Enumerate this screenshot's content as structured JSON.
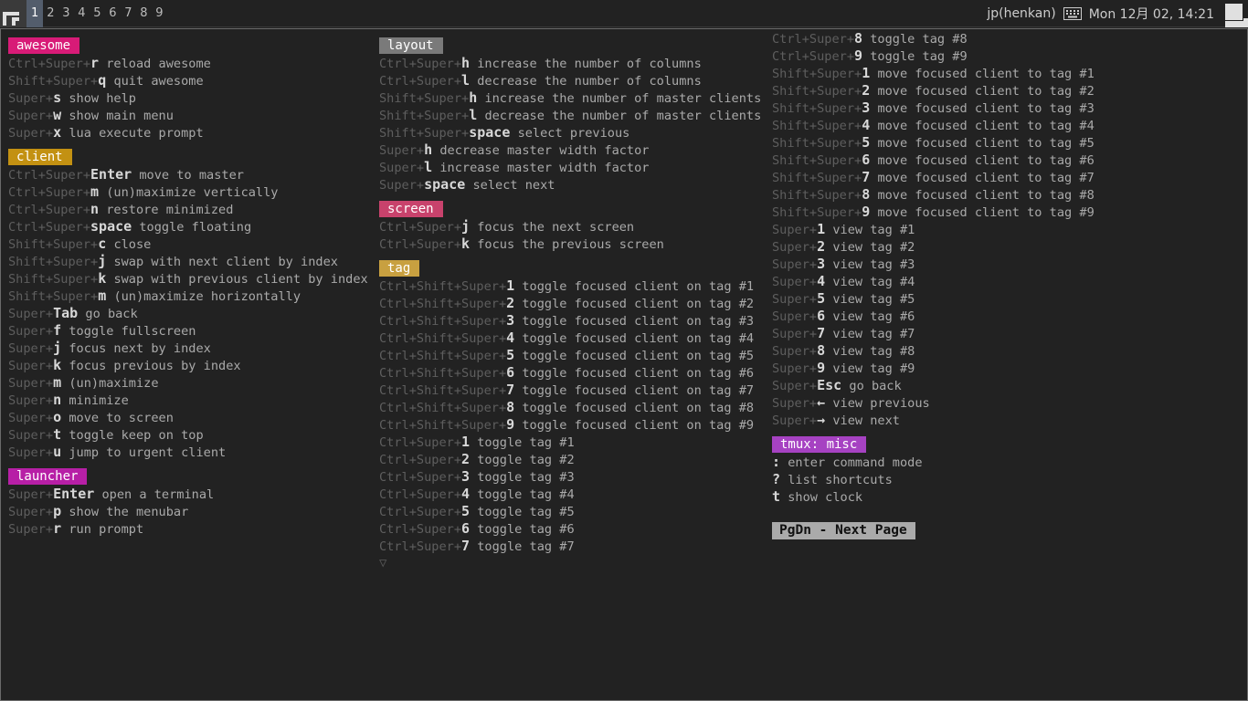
{
  "wibar": {
    "tags": [
      "1",
      "2",
      "3",
      "4",
      "5",
      "6",
      "7",
      "8",
      "9"
    ],
    "active_tag": "1",
    "keyboard_layout": "jp(henkan)",
    "keyboard_icon": "keyboard-icon",
    "clock": "Mon 12月 02, 14:21",
    "colors": {
      "bg": "#222222",
      "active_tag_bg": "#535d6c"
    }
  },
  "columns": [
    {
      "groups": [
        {
          "title": "awesome",
          "color": "#d81b77",
          "items": [
            {
              "mod": "Ctrl+Super+",
              "key": "r",
              "desc": "reload awesome"
            },
            {
              "mod": "Shift+Super+",
              "key": "q",
              "desc": "quit awesome"
            },
            {
              "mod": "Super+",
              "key": "s",
              "desc": "show help"
            },
            {
              "mod": "Super+",
              "key": "w",
              "desc": "show main menu"
            },
            {
              "mod": "Super+",
              "key": "x",
              "desc": "lua execute prompt"
            }
          ]
        },
        {
          "title": "client",
          "color": "#c39112",
          "items": [
            {
              "mod": "Ctrl+Super+",
              "key": "Enter",
              "desc": "move to master"
            },
            {
              "mod": "Ctrl+Super+",
              "key": "m",
              "desc": "(un)maximize vertically"
            },
            {
              "mod": "Ctrl+Super+",
              "key": "n",
              "desc": "restore minimized"
            },
            {
              "mod": "Ctrl+Super+",
              "key": "space",
              "desc": "toggle floating"
            },
            {
              "mod": "Shift+Super+",
              "key": "c",
              "desc": "close"
            },
            {
              "mod": "Shift+Super+",
              "key": "j",
              "desc": "swap with next client by index"
            },
            {
              "mod": "Shift+Super+",
              "key": "k",
              "desc": "swap with previous client by index"
            },
            {
              "mod": "Shift+Super+",
              "key": "m",
              "desc": "(un)maximize horizontally"
            },
            {
              "mod": "Super+",
              "key": "Tab",
              "desc": "go back"
            },
            {
              "mod": "Super+",
              "key": "f",
              "desc": "toggle fullscreen"
            },
            {
              "mod": "Super+",
              "key": "j",
              "desc": "focus next by index"
            },
            {
              "mod": "Super+",
              "key": "k",
              "desc": "focus previous by index"
            },
            {
              "mod": "Super+",
              "key": "m",
              "desc": "(un)maximize"
            },
            {
              "mod": "Super+",
              "key": "n",
              "desc": "minimize"
            },
            {
              "mod": "Super+",
              "key": "o",
              "desc": "move to screen"
            },
            {
              "mod": "Super+",
              "key": "t",
              "desc": "toggle keep on top"
            },
            {
              "mod": "Super+",
              "key": "u",
              "desc": "jump to urgent client"
            }
          ]
        },
        {
          "title": "launcher",
          "color": "#b71fa6",
          "items": [
            {
              "mod": "Super+",
              "key": "Enter",
              "desc": "open a terminal"
            },
            {
              "mod": "Super+",
              "key": "p",
              "desc": "show the menubar"
            },
            {
              "mod": "Super+",
              "key": "r",
              "desc": "run prompt"
            }
          ]
        }
      ]
    },
    {
      "groups": [
        {
          "title": "layout",
          "color": "#7a7a7a",
          "items": [
            {
              "mod": "Ctrl+Super+",
              "key": "h",
              "desc": "increase the number of columns"
            },
            {
              "mod": "Ctrl+Super+",
              "key": "l",
              "desc": "decrease the number of columns"
            },
            {
              "mod": "Shift+Super+",
              "key": "h",
              "desc": "increase the number of master clients"
            },
            {
              "mod": "Shift+Super+",
              "key": "l",
              "desc": "decrease the number of master clients"
            },
            {
              "mod": "Shift+Super+",
              "key": "space",
              "desc": "select previous"
            },
            {
              "mod": "Super+",
              "key": "h",
              "desc": "decrease master width factor"
            },
            {
              "mod": "Super+",
              "key": "l",
              "desc": "increase master width factor"
            },
            {
              "mod": "Super+",
              "key": "space",
              "desc": "select next"
            }
          ]
        },
        {
          "title": "screen",
          "color": "#c8426c",
          "items": [
            {
              "mod": "Ctrl+Super+",
              "key": "j",
              "desc": "focus the next screen"
            },
            {
              "mod": "Ctrl+Super+",
              "key": "k",
              "desc": "focus the previous screen"
            }
          ]
        },
        {
          "title": "tag",
          "color": "#c8a040",
          "items": [
            {
              "mod": "Ctrl+Shift+Super+",
              "key": "1",
              "desc": "toggle focused client on tag #1"
            },
            {
              "mod": "Ctrl+Shift+Super+",
              "key": "2",
              "desc": "toggle focused client on tag #2"
            },
            {
              "mod": "Ctrl+Shift+Super+",
              "key": "3",
              "desc": "toggle focused client on tag #3"
            },
            {
              "mod": "Ctrl+Shift+Super+",
              "key": "4",
              "desc": "toggle focused client on tag #4"
            },
            {
              "mod": "Ctrl+Shift+Super+",
              "key": "5",
              "desc": "toggle focused client on tag #5"
            },
            {
              "mod": "Ctrl+Shift+Super+",
              "key": "6",
              "desc": "toggle focused client on tag #6"
            },
            {
              "mod": "Ctrl+Shift+Super+",
              "key": "7",
              "desc": "toggle focused client on tag #7"
            },
            {
              "mod": "Ctrl+Shift+Super+",
              "key": "8",
              "desc": "toggle focused client on tag #8"
            },
            {
              "mod": "Ctrl+Shift+Super+",
              "key": "9",
              "desc": "toggle focused client on tag #9"
            },
            {
              "mod": "Ctrl+Super+",
              "key": "1",
              "desc": "toggle tag #1"
            },
            {
              "mod": "Ctrl+Super+",
              "key": "2",
              "desc": "toggle tag #2"
            },
            {
              "mod": "Ctrl+Super+",
              "key": "3",
              "desc": "toggle tag #3"
            },
            {
              "mod": "Ctrl+Super+",
              "key": "4",
              "desc": "toggle tag #4"
            },
            {
              "mod": "Ctrl+Super+",
              "key": "5",
              "desc": "toggle tag #5"
            },
            {
              "mod": "Ctrl+Super+",
              "key": "6",
              "desc": "toggle tag #6"
            },
            {
              "mod": "Ctrl+Super+",
              "key": "7",
              "desc": "toggle tag #7"
            }
          ],
          "more_marker": "▽"
        }
      ]
    },
    {
      "groups": [
        {
          "title": "",
          "color": "",
          "items": [
            {
              "mod": "Ctrl+Super+",
              "key": "8",
              "desc": "toggle tag #8"
            },
            {
              "mod": "Ctrl+Super+",
              "key": "9",
              "desc": "toggle tag #9"
            },
            {
              "mod": "Shift+Super+",
              "key": "1",
              "desc": "move focused client to tag #1"
            },
            {
              "mod": "Shift+Super+",
              "key": "2",
              "desc": "move focused client to tag #2"
            },
            {
              "mod": "Shift+Super+",
              "key": "3",
              "desc": "move focused client to tag #3"
            },
            {
              "mod": "Shift+Super+",
              "key": "4",
              "desc": "move focused client to tag #4"
            },
            {
              "mod": "Shift+Super+",
              "key": "5",
              "desc": "move focused client to tag #5"
            },
            {
              "mod": "Shift+Super+",
              "key": "6",
              "desc": "move focused client to tag #6"
            },
            {
              "mod": "Shift+Super+",
              "key": "7",
              "desc": "move focused client to tag #7"
            },
            {
              "mod": "Shift+Super+",
              "key": "8",
              "desc": "move focused client to tag #8"
            },
            {
              "mod": "Shift+Super+",
              "key": "9",
              "desc": "move focused client to tag #9"
            },
            {
              "mod": "Super+",
              "key": "1",
              "desc": "view tag #1"
            },
            {
              "mod": "Super+",
              "key": "2",
              "desc": "view tag #2"
            },
            {
              "mod": "Super+",
              "key": "3",
              "desc": "view tag #3"
            },
            {
              "mod": "Super+",
              "key": "4",
              "desc": "view tag #4"
            },
            {
              "mod": "Super+",
              "key": "5",
              "desc": "view tag #5"
            },
            {
              "mod": "Super+",
              "key": "6",
              "desc": "view tag #6"
            },
            {
              "mod": "Super+",
              "key": "7",
              "desc": "view tag #7"
            },
            {
              "mod": "Super+",
              "key": "8",
              "desc": "view tag #8"
            },
            {
              "mod": "Super+",
              "key": "9",
              "desc": "view tag #9"
            },
            {
              "mod": "Super+",
              "key": "Esc",
              "desc": "go back"
            },
            {
              "mod": "Super+",
              "key": "←",
              "desc": "view previous"
            },
            {
              "mod": "Super+",
              "key": "→",
              "desc": "view next"
            }
          ]
        },
        {
          "title": "tmux: misc",
          "color": "#a642c2",
          "items": [
            {
              "mod": "",
              "key": ":",
              "desc": "enter command mode"
            },
            {
              "mod": "",
              "key": "?",
              "desc": "list shortcuts"
            },
            {
              "mod": "",
              "key": "t",
              "desc": "show clock"
            }
          ]
        }
      ],
      "footer": "PgDn - Next Page"
    }
  ]
}
